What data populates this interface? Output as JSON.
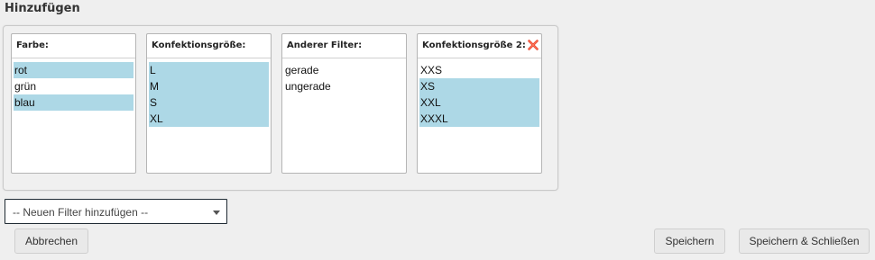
{
  "page": {
    "title": "Hinzufügen"
  },
  "filters": [
    {
      "header": "Farbe:",
      "removable": false,
      "options": [
        {
          "label": "rot",
          "selected": true
        },
        {
          "label": "grün",
          "selected": false
        },
        {
          "label": "blau",
          "selected": true
        }
      ]
    },
    {
      "header": "Konfektionsgröße:",
      "removable": false,
      "options": [
        {
          "label": "L",
          "selected": true
        },
        {
          "label": "M",
          "selected": true
        },
        {
          "label": "S",
          "selected": true
        },
        {
          "label": "XL",
          "selected": true
        }
      ]
    },
    {
      "header": "Anderer Filter:",
      "removable": false,
      "options": [
        {
          "label": "gerade",
          "selected": false
        },
        {
          "label": "ungerade",
          "selected": false
        }
      ]
    },
    {
      "header": "Konfektionsgröße 2:",
      "removable": true,
      "options": [
        {
          "label": "XXS",
          "selected": false
        },
        {
          "label": "XS",
          "selected": true
        },
        {
          "label": "XXL",
          "selected": true
        },
        {
          "label": "XXXL",
          "selected": true
        }
      ]
    }
  ],
  "add_filter": {
    "selected_label": "-- Neuen Filter hinzufügen --"
  },
  "buttons": {
    "cancel": "Abbrechen",
    "save": "Speichern",
    "save_close": "Speichern & Schließen"
  },
  "colors": {
    "selection": "#add8e6",
    "remove_icon": "#e8402a"
  },
  "icons": {
    "remove": "close-icon",
    "dropdown": "chevron-down-icon"
  }
}
